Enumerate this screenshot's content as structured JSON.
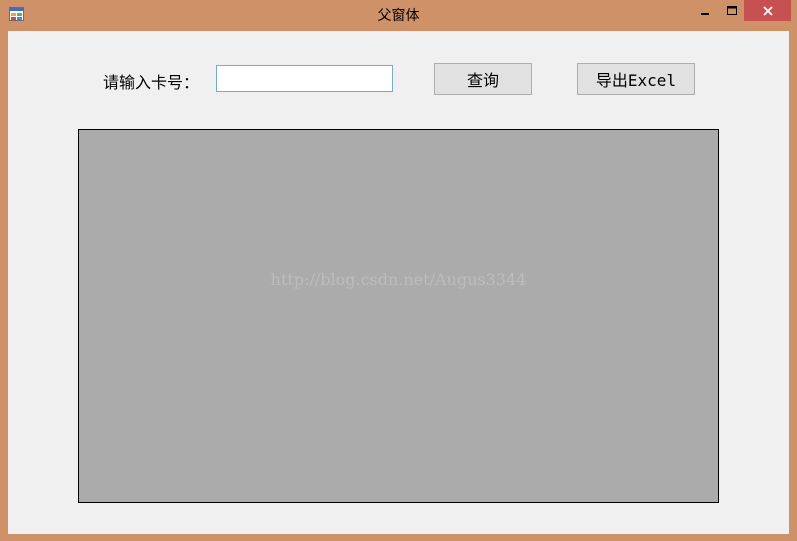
{
  "window": {
    "title": "父窗体",
    "icons": [
      "app-icon",
      "minimize-icon",
      "maximize-icon",
      "close-icon"
    ]
  },
  "form": {
    "card_label": "请输入卡号：",
    "card_value": "",
    "query_button": "查询",
    "export_button": "导出Excel"
  },
  "panel": {
    "watermark": "http://blog.csdn.net/Augus3344"
  },
  "colors": {
    "frame": "#cf9168",
    "close": "#c75050",
    "client_bg": "#f0f0f0",
    "panel_bg": "#ababab",
    "input_border": "#7aa7d4"
  }
}
